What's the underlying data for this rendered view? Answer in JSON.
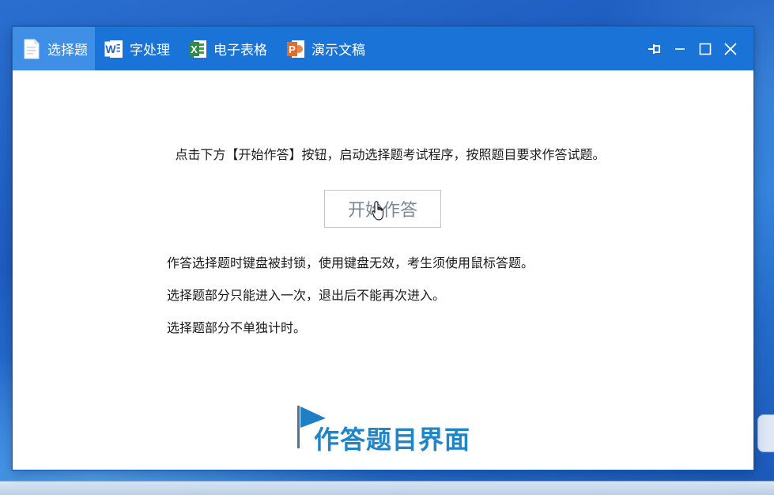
{
  "window": {
    "tabs": [
      {
        "label": "选择题",
        "icon": "document-icon",
        "active": true
      },
      {
        "label": "字处理",
        "icon": "word-icon",
        "active": false
      },
      {
        "label": "电子表格",
        "icon": "excel-icon",
        "active": false
      },
      {
        "label": "演示文稿",
        "icon": "powerpoint-icon",
        "active": false
      }
    ],
    "controls": [
      "pin-icon",
      "minimize-icon",
      "maximize-icon",
      "close-icon"
    ]
  },
  "main": {
    "instruction": "点击下方【开始作答】按钮，启动选择题考试程序，按照题目要求作答试题。",
    "start_button": "开始作答",
    "notes": [
      "作答选择题时键盘被封锁，使用键盘无效，考生须使用鼠标答题。",
      "选择题部分只能进入一次，退出后不能再次进入。",
      "选择题部分不单独计时。"
    ]
  },
  "caption": "作答题目界面",
  "colors": {
    "titlebar": "#1a74d8",
    "active_tab": "#3f8fe6",
    "caption": "#1e86c8",
    "desktop": "#2a6fd0"
  }
}
